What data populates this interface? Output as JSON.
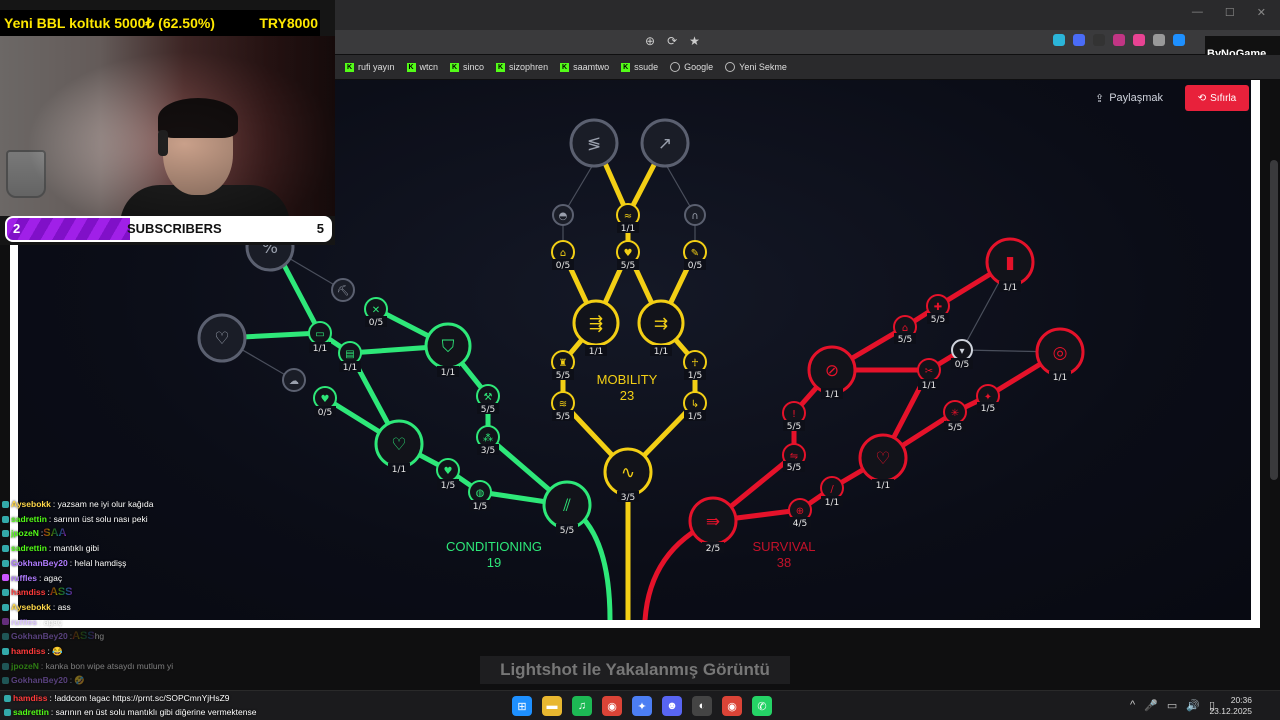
{
  "browser": {
    "window_controls": [
      "—",
      "☐",
      "✕"
    ],
    "address_icons": [
      "⊕",
      "⟳",
      "★"
    ],
    "extension_colors": [
      "#2bb5d9",
      "#4a6cf7",
      "#333",
      "#c13584",
      "#e84393",
      "#999",
      "#1e90ff"
    ],
    "overlay_label": "ByNoGame",
    "bookmarks": [
      {
        "label": "rufi yayın",
        "icon": "kick"
      },
      {
        "label": "wtcn",
        "icon": "kick"
      },
      {
        "label": "sinco",
        "icon": "kick"
      },
      {
        "label": "sizophren",
        "icon": "kick"
      },
      {
        "label": "saamtwo",
        "icon": "kick"
      },
      {
        "label": "ssude",
        "icon": "kick"
      },
      {
        "label": "Google",
        "icon": "globe"
      },
      {
        "label": "Yeni Sekme",
        "icon": "globe"
      }
    ]
  },
  "app": {
    "share_label": "Paylaşmak",
    "reset_label": "Sıfırla",
    "branches": {
      "conditioning": {
        "name": "CONDITIONING",
        "points": "19",
        "color": "#2ee879"
      },
      "mobility": {
        "name": "MOBILITY",
        "points": "23",
        "color": "#f3cf15"
      },
      "survival": {
        "name": "SURVIVAL",
        "points": "38",
        "color": "#e5122a"
      }
    },
    "node_labels": {
      "m1": "1/1",
      "m2": "5/5",
      "m3": "0/5",
      "m4": "5/5",
      "m5": "0/5",
      "m6": "1/1",
      "m7": "1/1",
      "m8": "5/5",
      "m9": "5/5",
      "m10": "1/5",
      "m11": "1/5",
      "m12": "3/5",
      "c1": "0/5",
      "c2": "1/1",
      "c3": "1/1",
      "c4": "1/1",
      "c5": "0/5",
      "c6": "5/5",
      "c7": "3/5",
      "c8": "1/1",
      "c9": "1/5",
      "c10": "1/5",
      "c11": "5/5",
      "s1": "1/1",
      "s2": "5/5",
      "s3": "5/5",
      "s4": "0/5",
      "s5": "1/1",
      "s6": "1/1",
      "s7": "1/1",
      "s8": "5/5",
      "s9": "1/5",
      "s10": "5/5",
      "s11": "5/5",
      "s12": "1/1",
      "s13": "1/1",
      "s14": "4/5",
      "s15": "2/5"
    }
  },
  "stream": {
    "donation_text": "Yeni BBL koltuk",
    "donation_amount": "5000₺ (62.50%)",
    "donation_goal": "TRY8000",
    "subs_current": "2",
    "subs_label": "SUBSCRIBERS",
    "subs_goal": "5",
    "subs_progress": 0.4
  },
  "chat": [
    {
      "user": "Aysebokk",
      "color": "#ffd84a",
      "msg": ": yazsam ne iyi olur kağıda",
      "badge": "#3aa"
    },
    {
      "user": "sadrettin",
      "color": "#53fc18",
      "msg": ": sarının üst solu nası peki",
      "badge": "#3aa"
    },
    {
      "user": "jpozeN",
      "color": "#53fc18",
      "msg": ": ",
      "emote": "SAA",
      "badge": "#3aa"
    },
    {
      "user": "sadrettin",
      "color": "#53fc18",
      "msg": ": mantıklı gibi",
      "badge": "#3aa"
    },
    {
      "user": "GokhanBey20",
      "color": "#b07cff",
      "msg": ": helal hamdişş",
      "badge": "#3aa"
    },
    {
      "user": "ruffles",
      "color": "#b07cff",
      "msg": ": agaç",
      "badge": "#c5f"
    },
    {
      "user": "hamdiss",
      "color": "#ff3b3b",
      "msg": ": ",
      "emote": "ASS",
      "badge": "#3aa"
    },
    {
      "user": "Aysebokk",
      "color": "#ffd84a",
      "msg": ": ass",
      "badge": "#3aa"
    },
    {
      "user": "ruffles",
      "color": "#b07cff",
      "msg": ": agaç",
      "badge": "#c5f",
      "faded": true
    },
    {
      "user": "GokhanBey20",
      "color": "#b07cff",
      "msg": ": ",
      "emote": "ASS",
      "tail": " hg",
      "badge": "#3aa",
      "faded": true
    },
    {
      "user": "hamdiss",
      "color": "#ff3b3b",
      "msg": ": 😂",
      "badge": "#3aa"
    },
    {
      "user": "jpozeN",
      "color": "#53fc18",
      "msg": ": kanka bon wipe atsaydı mutlum yi",
      "badge": "#3aa",
      "faded": true
    },
    {
      "user": "GokhanBey20",
      "color": "#b07cff",
      "msg": ": 🤣",
      "badge": "#3aa",
      "faded": true
    }
  ],
  "taskbar_chat": [
    {
      "user": "hamdiss",
      "color": "#ff3b3b",
      "msg": ": !addcom !agac https://prnt.sc/SOPCmnYjHsZ9"
    },
    {
      "user": "sadrettin",
      "color": "#53fc18",
      "msg": ": sarının en üst solu mantıklı gibi diğerine vermektense"
    }
  ],
  "watermark": "Lightshot ile Yakalanmış Görüntü",
  "taskbar": {
    "apps": [
      {
        "name": "windows-start",
        "color": "#1e90ff",
        "glyph": "⊞"
      },
      {
        "name": "file-explorer",
        "color": "#e8b730",
        "glyph": "▬"
      },
      {
        "name": "spotify",
        "color": "#1db954",
        "glyph": "♫"
      },
      {
        "name": "chrome",
        "color": "#db4437",
        "glyph": "◉"
      },
      {
        "name": "app-blue",
        "color": "#4c7ef3",
        "glyph": "✦"
      },
      {
        "name": "discord",
        "color": "#5865f2",
        "glyph": "☻"
      },
      {
        "name": "obs",
        "color": "#444",
        "glyph": "◐"
      },
      {
        "name": "chrome-2",
        "color": "#db4437",
        "glyph": "◉"
      },
      {
        "name": "whatsapp",
        "color": "#25d366",
        "glyph": "✆"
      }
    ],
    "tray_icons": [
      "^",
      "🎤",
      "▭",
      "🔊",
      "▯"
    ],
    "time": "20:36",
    "date": "23.12.2025"
  }
}
